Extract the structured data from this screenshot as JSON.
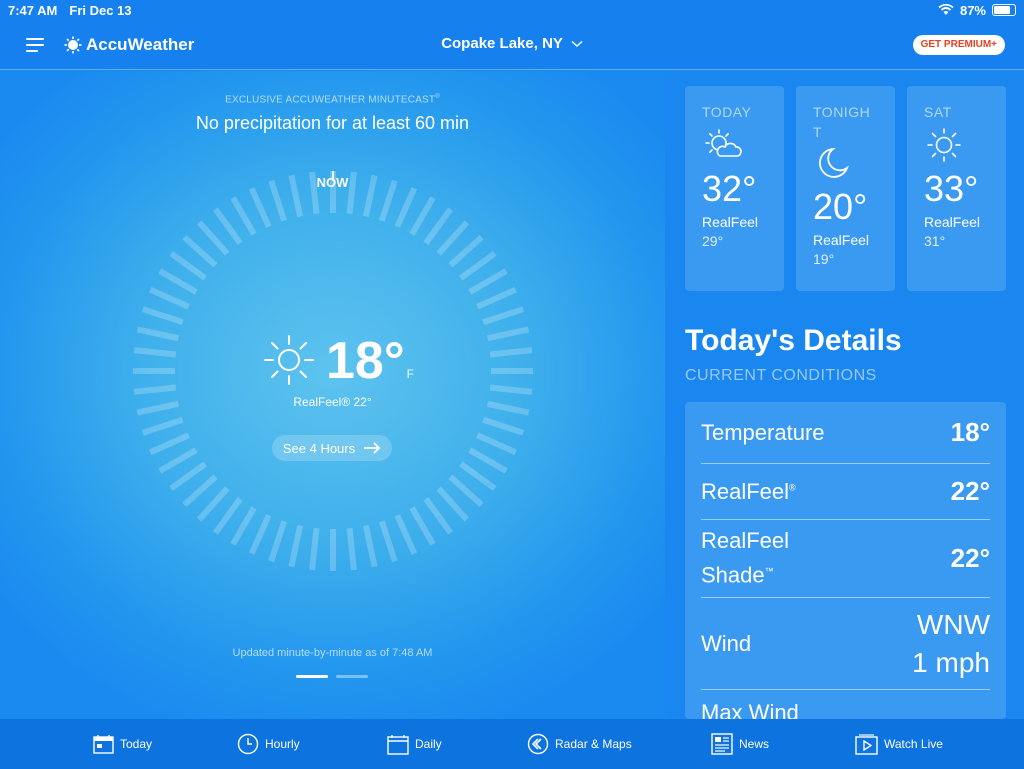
{
  "status_bar": {
    "time": "7:47 AM",
    "date": "Fri Dec 13",
    "battery": "87%"
  },
  "header": {
    "logo": "AccuWeather",
    "location": "Copake Lake, NY",
    "premium": "GET PREMIUM+"
  },
  "minutecast": {
    "title": "EXCLUSIVE ACCUWEATHER MINUTECAST",
    "title_mark": "®",
    "headline": "No precipitation for at least 60 min",
    "now_label": "NOW",
    "current_temp": "18°",
    "unit": "F",
    "realfeel": "RealFeel® 22°",
    "see_hours": "See 4 Hours",
    "updated": "Updated minute-by-minute as of 7:48 AM"
  },
  "forecast": [
    {
      "label": "TODAY",
      "icon": "partly-sunny-icon",
      "temp": "32°",
      "realfeel_label": "RealFeel",
      "realfeel_value": "29°"
    },
    {
      "label": "TONIGHT",
      "icon": "moon-icon",
      "temp": "20°",
      "realfeel_label": "RealFeel",
      "realfeel_value": "19°"
    },
    {
      "label": "SAT",
      "icon": "sun-icon",
      "temp": "33°",
      "realfeel_label": "RealFeel",
      "realfeel_value": "31°"
    }
  ],
  "details": {
    "title": "Today's Details",
    "subtitle": "CURRENT CONDITIONS",
    "rows": [
      {
        "label": "Temperature",
        "value": "18°"
      },
      {
        "label": "RealFeel",
        "label_mark": "®",
        "value": "22°"
      },
      {
        "label": "RealFeel Shade",
        "label_mark": "™",
        "value": "22°"
      },
      {
        "label": "Wind",
        "value": "WNW 1 mph"
      },
      {
        "label": "Max Wind",
        "value": ""
      }
    ]
  },
  "nav": [
    {
      "label": "Today",
      "icon": "calendar-today-icon"
    },
    {
      "label": "Hourly",
      "icon": "clock-icon"
    },
    {
      "label": "Daily",
      "icon": "calendar-icon"
    },
    {
      "label": "Radar & Maps",
      "icon": "radar-icon"
    },
    {
      "label": "News",
      "icon": "news-icon"
    },
    {
      "label": "Watch Live",
      "icon": "play-icon"
    }
  ],
  "colors": {
    "brand_blue": "#1580ee",
    "card_blue": "#3a9af2",
    "premium_red": "#e8421f"
  }
}
